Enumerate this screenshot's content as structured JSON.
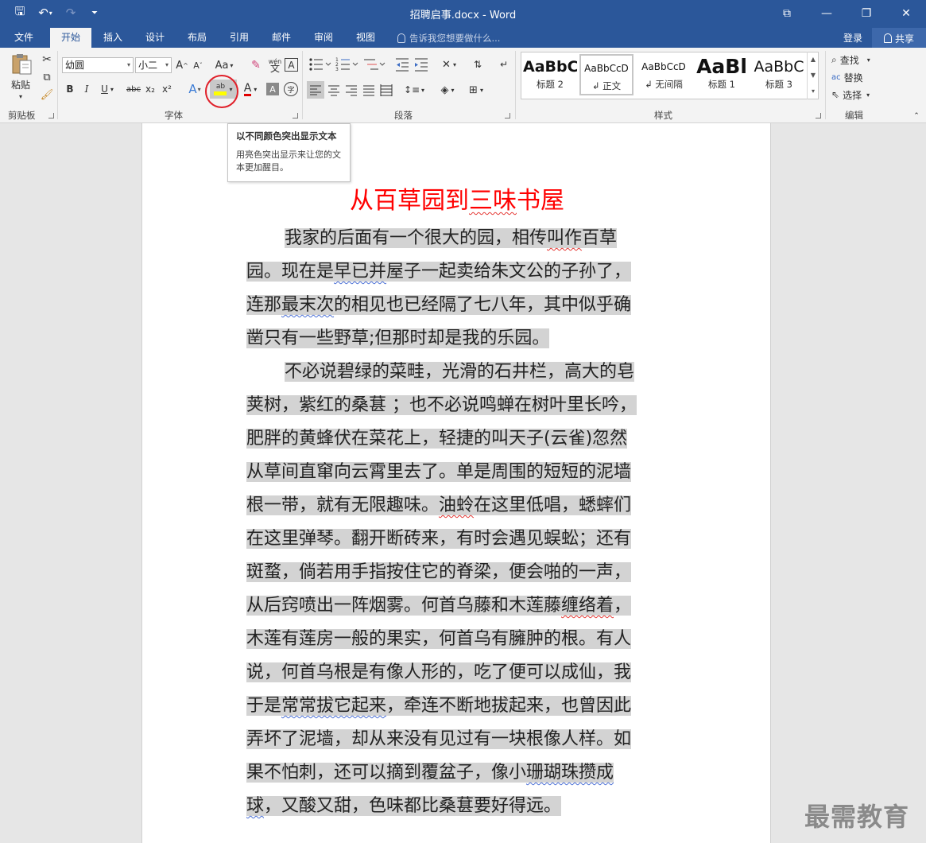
{
  "window": {
    "title": "招聘启事.docx - Word",
    "qat": {
      "save": "🖫",
      "undo": "↶",
      "redo": "↷",
      "customize": "⏷"
    },
    "controls": {
      "ribbon_display": "⧉",
      "minimize": "—",
      "restore": "❐",
      "close": "✕"
    }
  },
  "tabs": [
    "文件",
    "开始",
    "插入",
    "设计",
    "布局",
    "引用",
    "邮件",
    "审阅",
    "视图"
  ],
  "active_tab": "开始",
  "tell_me": "告诉我您想要做什么...",
  "account": {
    "login": "登录",
    "share": "共享"
  },
  "ribbon": {
    "clipboard": {
      "paste": "粘贴",
      "label": "剪贴板"
    },
    "font": {
      "family": "幼圆",
      "size": "小二",
      "grow": "A",
      "shrink": "A",
      "case": "Aa",
      "wen": "wén",
      "wen_char": "文",
      "border_char": "A",
      "bold": "B",
      "italic": "I",
      "underline": "U",
      "strike": "abc",
      "sub": "x₂",
      "sup": "x²",
      "effects": "A",
      "highlight": "ab",
      "font_color": "A",
      "shade": "A",
      "enclose": "字",
      "label": "字体"
    },
    "paragraph": {
      "label": "段落"
    },
    "styles": {
      "label": "样式",
      "items": [
        {
          "preview": "AaBbC",
          "name": "标题 2"
        },
        {
          "preview": "AaBbCcD",
          "name": "正文"
        },
        {
          "preview": "AaBbCcD",
          "name": "无间隔"
        },
        {
          "preview": "AaBl",
          "name": "标题 1"
        },
        {
          "preview": "AaBbC",
          "name": "标题 3"
        }
      ]
    },
    "editing": {
      "find": "查找",
      "replace": "替换",
      "select": "选择",
      "label": "编辑"
    }
  },
  "tooltip": {
    "title": "以不同颜色突出显示文本",
    "body": "用亮色突出显示来让您的文本更加醒目。"
  },
  "document": {
    "heading": {
      "before": "从百草园到",
      "squiggle": "三味",
      "after": "书屋"
    },
    "lines": [
      [
        "    ",
        "我家的后面有一个很大的园，相传",
        "叫作",
        "百草"
      ],
      [
        "园。现在是",
        "早已并",
        "屋子一起卖给朱文公的子孙了，"
      ],
      [
        "连那",
        "最末次",
        "的相见也已经隔了七八年，其中似乎确"
      ],
      [
        "凿只有一些野草;但那时却是我的乐园。"
      ],
      [
        "    ",
        "不必说碧绿的菜畦，光滑的石井栏，高大的皂"
      ],
      [
        "荚树，紫红的桑葚 ；也不必说鸣蝉在树叶里长吟，"
      ],
      [
        "肥胖的黄蜂伏在菜花上，轻捷的叫天子(云雀)忽然"
      ],
      [
        "从草间直窜向云霄里去了。单是周围的短短的泥墙"
      ],
      [
        "根一带，就有无限趣味。",
        "油蛉",
        "在这里低唱，蟋蟀们"
      ],
      [
        "在这里弹琴。翻开断砖来，有时会遇见蜈蚣；还有"
      ],
      [
        "斑蝥，倘若用手指按住它的脊梁，便会啪的一声，"
      ],
      [
        "从后窍喷出一阵烟雾。何首乌藤和木莲藤",
        "缠络着",
        "，"
      ],
      [
        "木莲有莲房一般的果实，何首乌有臃肿的根。有人"
      ],
      [
        "说，何首乌根是有像人形的，吃了便可以成仙，我"
      ],
      [
        "于是",
        "常常拔它起来",
        "，牵连不断地拔起来，也曾因此"
      ],
      [
        "弄坏了泥墙，却从来没有见过有一块根像人样。如"
      ],
      [
        "果不怕刺，还可以摘到覆盆子，像小",
        "珊瑚珠攒成",
        ""
      ],
      [
        "球",
        "，又酸又甜，色味都比桑葚要好得远。"
      ]
    ]
  },
  "watermark": "最需教育",
  "colors": {
    "accent": "#2b579a",
    "heading_red": "#ff0000",
    "highlight_gray": "#d3d3d3",
    "circle_red": "#e0202a"
  }
}
